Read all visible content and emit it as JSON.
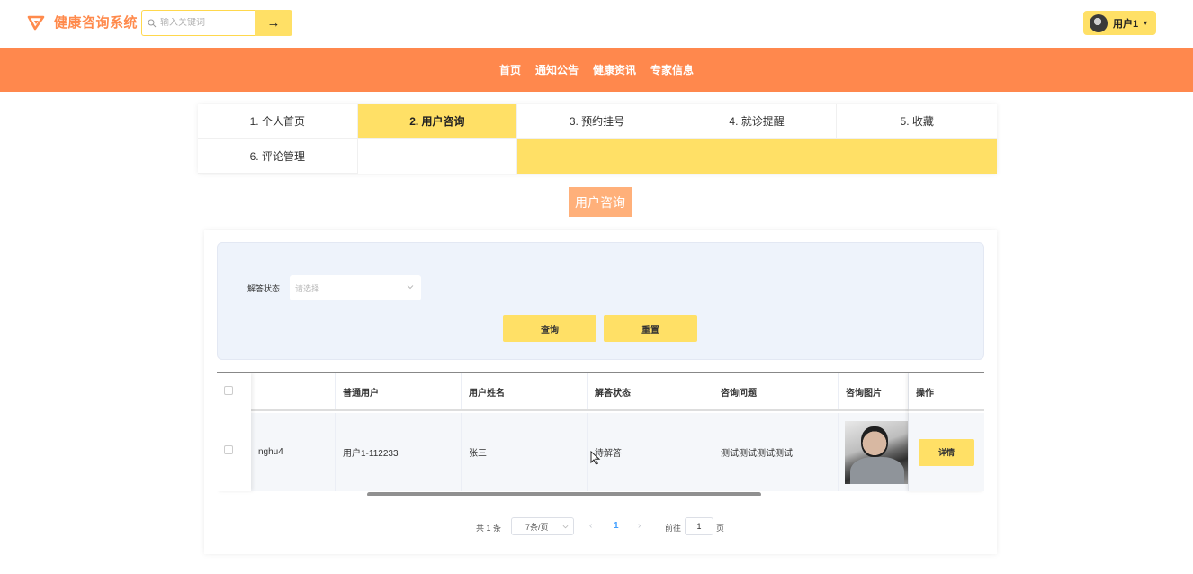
{
  "header": {
    "app_title": "健康咨询系统",
    "search_placeholder": "输入关键词",
    "search_button": "→",
    "user_name": "用户1",
    "accent_color": "#ff884d",
    "button_color": "#ffe066"
  },
  "nav": {
    "items": [
      {
        "label": "首页"
      },
      {
        "label": "通知公告"
      },
      {
        "label": "健康资讯"
      },
      {
        "label": "专家信息"
      }
    ]
  },
  "tabs": [
    {
      "label": "1. 个人首页",
      "active": false
    },
    {
      "label": "2. 用户咨询",
      "active": true
    },
    {
      "label": "3. 预约挂号",
      "active": false
    },
    {
      "label": "4. 就诊提醒",
      "active": false
    },
    {
      "label": "5. 收藏",
      "active": false
    },
    {
      "label": "6. 评论管理",
      "active": false
    }
  ],
  "section_title": "用户咨询",
  "filter": {
    "label": "解答状态",
    "select_placeholder": "请选择",
    "query_button": "查询",
    "reset_button": "重置"
  },
  "table": {
    "headers": [
      "普通用户",
      "用户姓名",
      "解答状态",
      "咨询问题",
      "咨询图片",
      "操作"
    ],
    "rows": [
      {
        "account": "nghu4",
        "user": "用户1-112233",
        "name": "张三",
        "status": "待解答",
        "question": "测试测试测试测试",
        "action": "详情"
      }
    ]
  },
  "pagination": {
    "total": "共 1 条",
    "page_size": "7条/页",
    "prev": "‹",
    "current_page": "1",
    "next": "›",
    "goto_label": "前往",
    "goto_value": "1",
    "page_suffix": "页"
  }
}
